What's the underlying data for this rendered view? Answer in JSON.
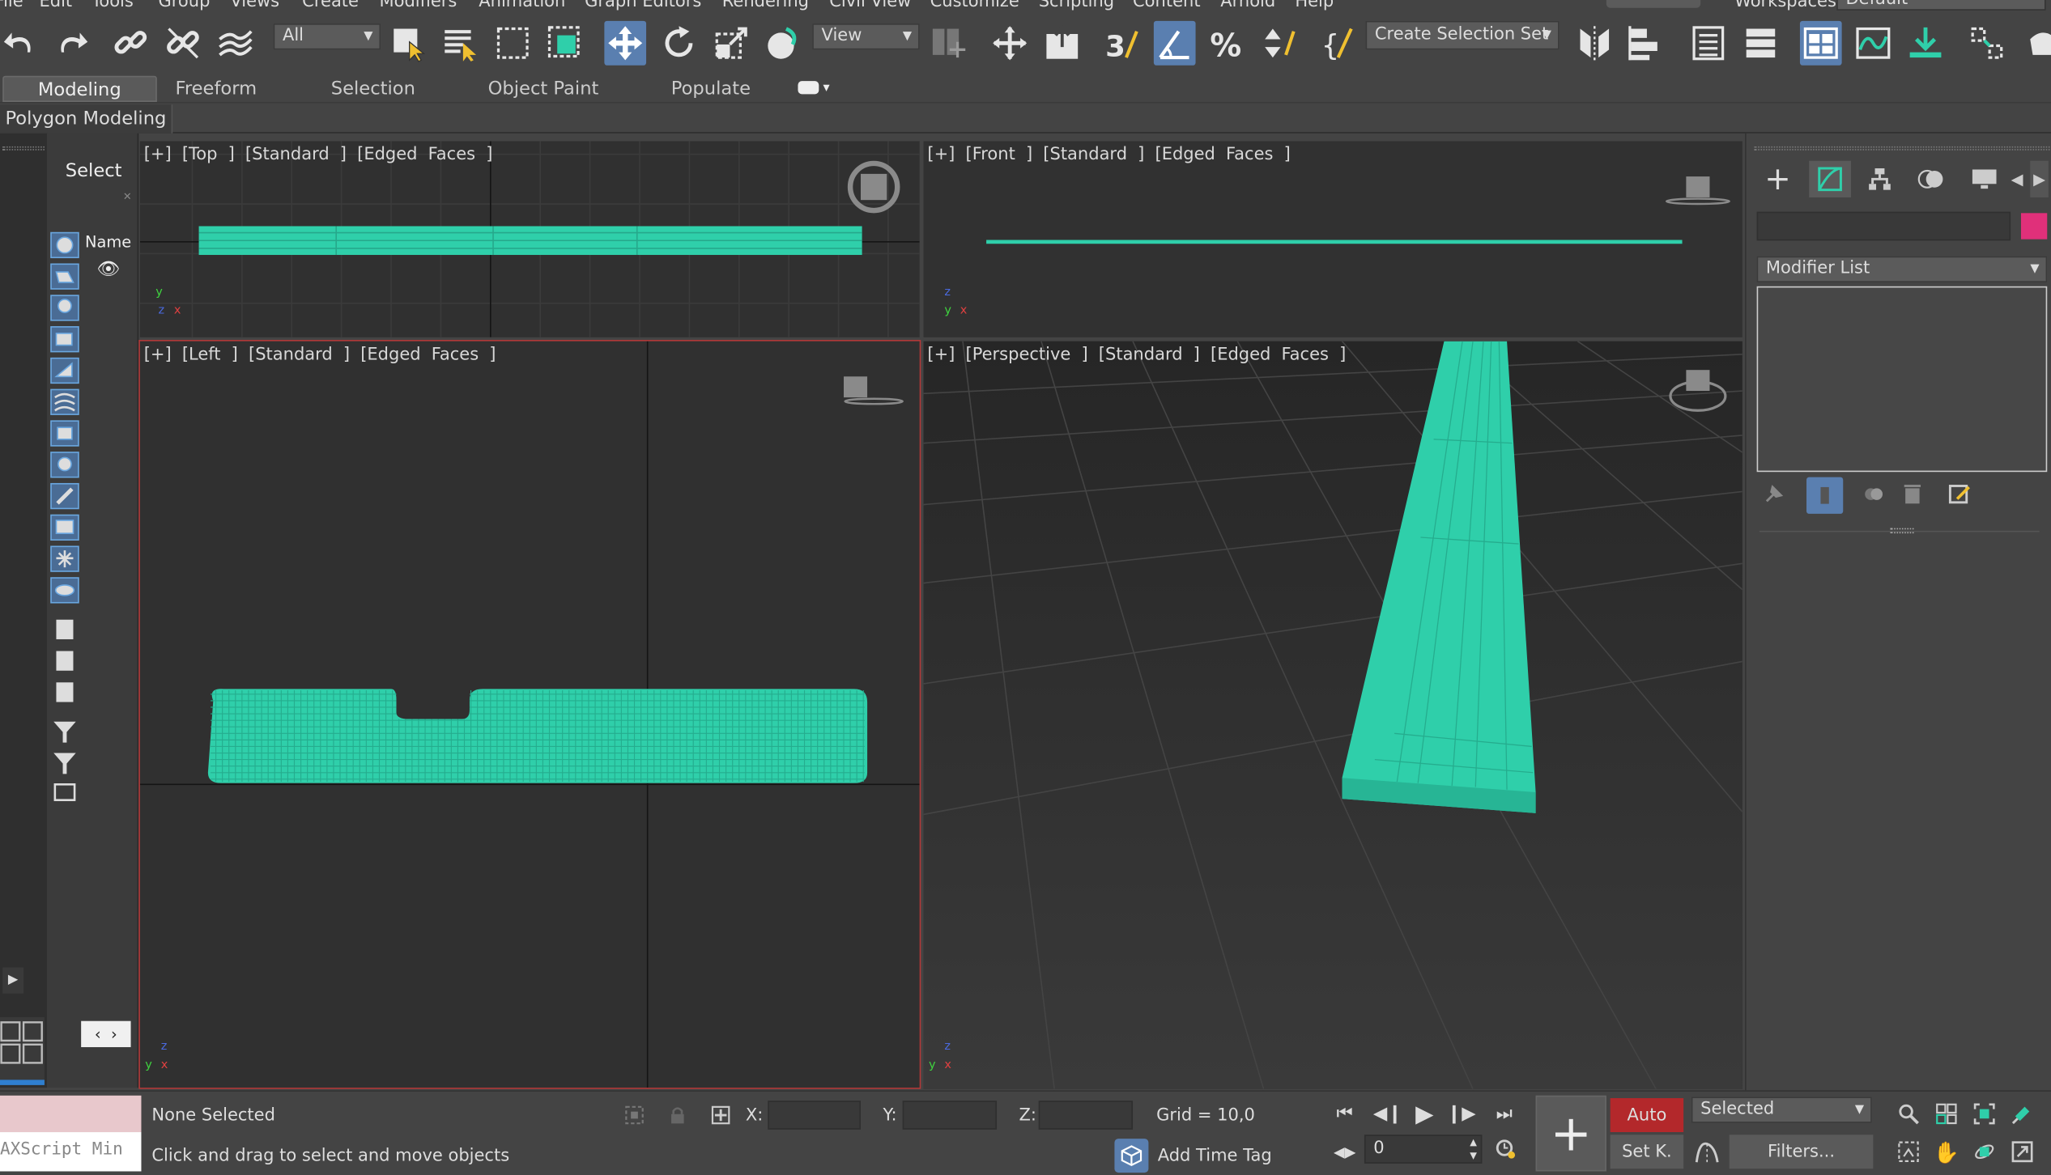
{
  "menu": [
    "File",
    "Edit",
    "Tools",
    "Group",
    "Views",
    "Create",
    "Modifiers",
    "Animation",
    "Graph Editors",
    "Rendering",
    "Civil View",
    "Customize",
    "Scripting",
    "Content",
    "Arnold",
    "Help"
  ],
  "workspaces_label": "Workspaces:",
  "workspace_value": "Default",
  "toolbar": {
    "selection_filter": "All",
    "ref_coord": "View",
    "selection_set": "Create Selection Set"
  },
  "ribbon": {
    "tabs": [
      "Modeling",
      "Freeform",
      "Selection",
      "Object Paint",
      "Populate"
    ],
    "active_tab": "Modeling",
    "panel_label": "Polygon Modeling"
  },
  "scene_explorer": {
    "select_label": "Select",
    "name_header": "Name"
  },
  "viewports": {
    "top": "[+] [Top ] [Standard ] [Edged Faces ]",
    "front": "[+] [Front ] [Standard ] [Edged Faces ]",
    "left": "[+] [Left ] [Standard ] [Edged Faces ]",
    "perspective": "[+] [Perspective ] [Standard ] [Edged Faces ]"
  },
  "command_panel": {
    "modifier_list": "Modifier List"
  },
  "status": {
    "selection": "None Selected",
    "prompt": "Click and drag to select and move objects",
    "maxscript": "AXScript Min",
    "x_label": "X:",
    "y_label": "Y:",
    "z_label": "Z:",
    "grid": "Grid = 10,0",
    "add_time_tag": "Add Time Tag",
    "frame": "0",
    "auto_key": "Auto",
    "set_key": "Set K.",
    "key_filter": "Selected",
    "filters": "Filters..."
  },
  "colors": {
    "object": "#2fcfaa",
    "accent": "#5a7fb0",
    "auto_key": "#b3282b",
    "object_color_swatch": "#e0307a"
  }
}
